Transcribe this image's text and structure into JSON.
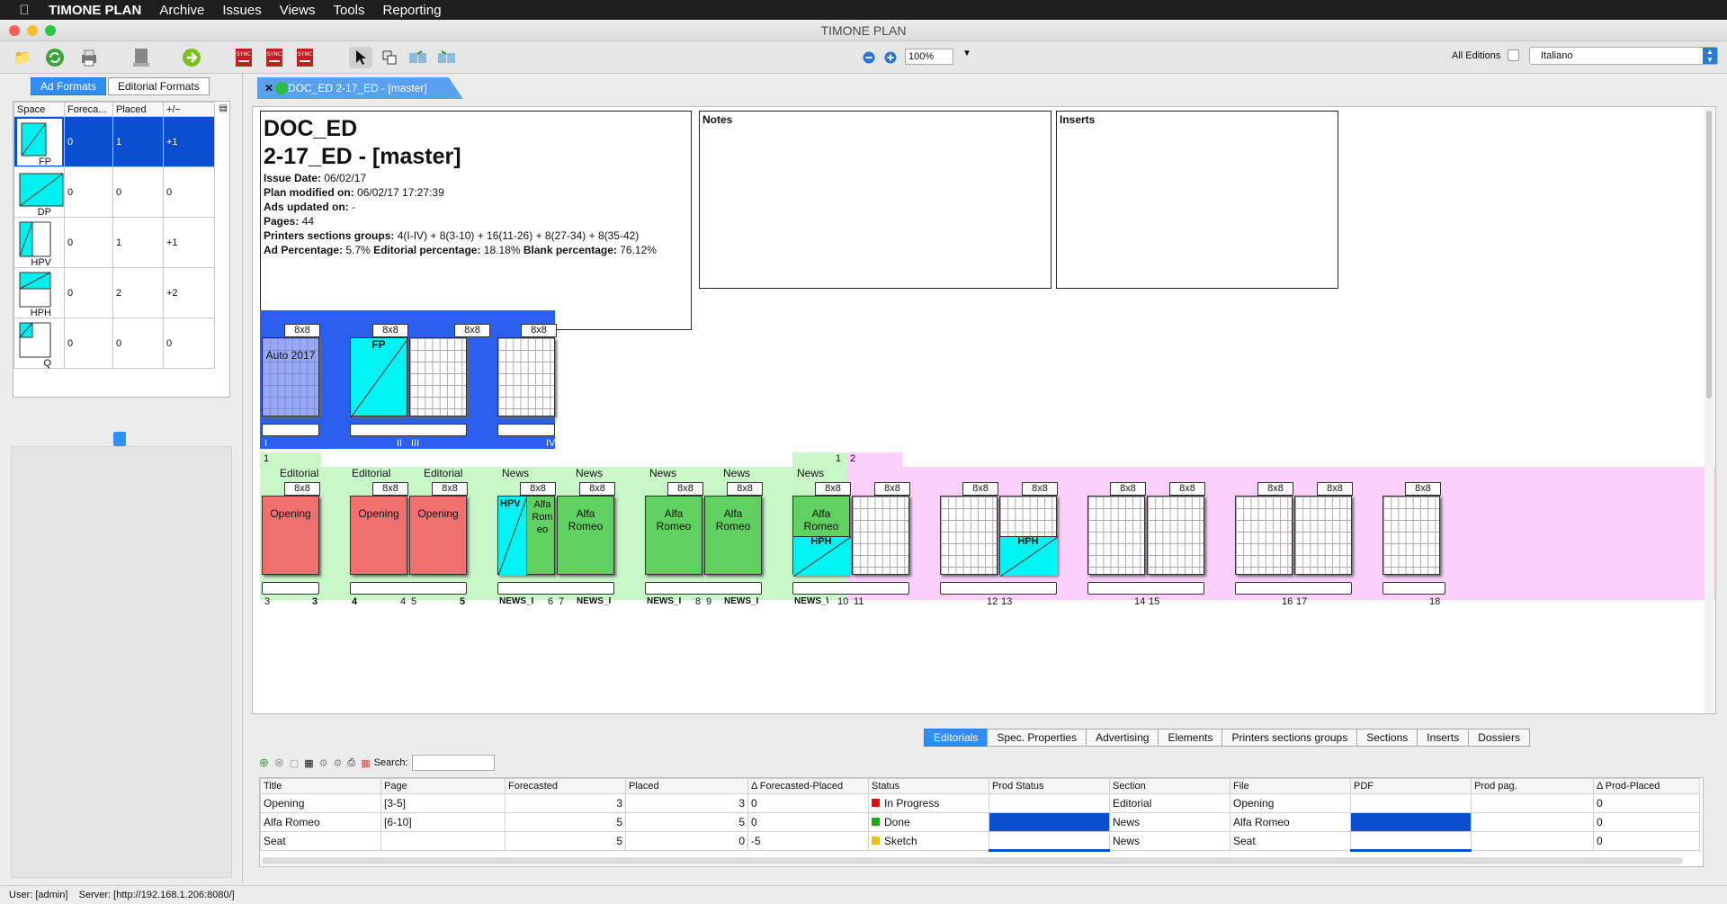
{
  "menubar": {
    "app": "TIMONE PLAN",
    "items": [
      "Archive",
      "Issues",
      "Views",
      "Tools",
      "Reporting"
    ]
  },
  "window": {
    "title": "TIMONE PLAN"
  },
  "toolbar": {
    "zoom": "100%",
    "all_editions_label": "All Editions",
    "language": "Italiano"
  },
  "left": {
    "tabs": [
      "Ad Formats",
      "Editorial Formats"
    ],
    "columns": [
      "Space",
      "Foreca...",
      "Placed",
      "+/−"
    ],
    "rows": [
      {
        "label": "FP",
        "forecast": "0",
        "placed": "1",
        "diff": "+1"
      },
      {
        "label": "DP",
        "forecast": "0",
        "placed": "0",
        "diff": "0"
      },
      {
        "label": "HPV",
        "forecast": "0",
        "placed": "1",
        "diff": "+1"
      },
      {
        "label": "HPH",
        "forecast": "0",
        "placed": "2",
        "diff": "+2"
      },
      {
        "label": "Q",
        "forecast": "0",
        "placed": "0",
        "diff": "0"
      }
    ]
  },
  "document": {
    "tab": "DOC_ED 2-17_ED - [master]",
    "name": "DOC_ED",
    "sub": "2-17_ED - [master]",
    "issue_date_label": "Issue Date:",
    "issue_date": "06/02/17",
    "plan_modified_label": "Plan modified on:",
    "plan_modified": "06/02/17 17:27:39",
    "ads_updated_label": "Ads updated on:",
    "ads_updated": "-",
    "pages_label": "Pages:",
    "pages": "44",
    "printers_label": "Printers sections groups:",
    "printers": "4(I-IV) + 8(3-10) + 16(11-26) + 8(27-34) + 8(35-42)",
    "ad_pct_label": "Ad Percentage:",
    "ad_pct": "5.7%",
    "ed_pct_label": "Editorial percentage:",
    "ed_pct": "18.18%",
    "blank_pct_label": "Blank percentage:",
    "blank_pct": "76.12%",
    "notes_label": "Notes",
    "inserts_label": "Inserts"
  },
  "cover": {
    "size": "8x8",
    "pages": [
      {
        "num": "I",
        "label": "Auto 2017"
      },
      {
        "num": "II",
        "label": "FP"
      },
      {
        "num": "III",
        "label": ""
      },
      {
        "num": "IV",
        "label": ""
      }
    ]
  },
  "flat": {
    "size": "8x8",
    "marker_left": "1",
    "marker_mid": "1",
    "marker_right": "2",
    "sections": [
      "Editorial",
      "Editorial",
      "Editorial",
      "News",
      "News",
      "News",
      "News",
      "News"
    ],
    "page_labels": [
      "Opening",
      "Opening",
      "Opening",
      "HPV",
      "Alfa Rom eo",
      "Alfa Romeo",
      "Alfa Romeo",
      "Alfa Romeo",
      "Alfa Romeo",
      "HPH",
      "HPH"
    ],
    "nums": [
      "3",
      "3",
      "4",
      "4",
      "5",
      "5",
      "6",
      "7",
      "8",
      "9",
      "10",
      "11",
      "12",
      "13",
      "14",
      "15",
      "16",
      "17",
      "18"
    ],
    "bar_texts": [
      "NEWS_I",
      "NEWS_I",
      "NEWS_I",
      "NEWS_I",
      "NEWS_\\"
    ]
  },
  "bottom": {
    "tabs": [
      "Editorials",
      "Spec. Properties",
      "Advertising",
      "Elements",
      "Printers sections groups",
      "Sections",
      "Inserts",
      "Dossiers"
    ],
    "search_label": "Search:",
    "columns": [
      "Title",
      "Page",
      "Forecasted",
      "Placed",
      "Δ Forecasted-Placed",
      "Status",
      "Prod Status",
      "Section",
      "File",
      "PDF",
      "Prod pag.",
      "Δ Prod-Placed"
    ],
    "rows": [
      {
        "title": "Opening",
        "page": "[3-5]",
        "forecasted": "3",
        "placed": "3",
        "delta": "0",
        "status": "In Progress",
        "status_color": "#e01010",
        "section": "Editorial",
        "file": "Opening",
        "dprod": "0"
      },
      {
        "title": "Alfa Romeo",
        "page": "[6-10]",
        "forecasted": "5",
        "placed": "5",
        "delta": "0",
        "status": "Done",
        "status_color": "#10b010",
        "section": "News",
        "file": "Alfa Romeo",
        "dprod": "0"
      },
      {
        "title": "Seat",
        "page": "",
        "forecasted": "5",
        "placed": "0",
        "delta": "-5",
        "status": "Sketch",
        "status_color": "#f0c000",
        "section": "News",
        "file": "Seat",
        "dprod": "0"
      }
    ]
  },
  "status": {
    "user": "User: [admin]",
    "server": "Server: [http://192.168.1.206:8080/]"
  }
}
